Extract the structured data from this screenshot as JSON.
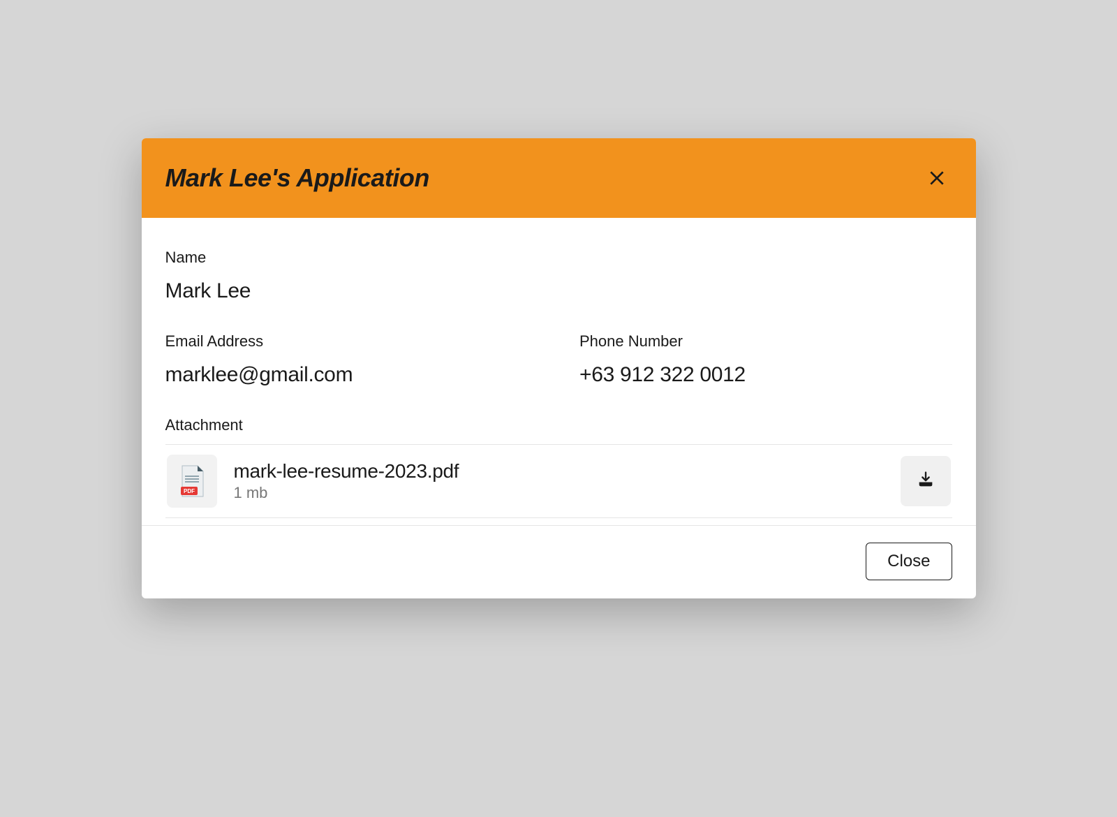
{
  "modal": {
    "title": "Mark Lee's Application",
    "fields": {
      "name": {
        "label": "Name",
        "value": "Mark Lee"
      },
      "email": {
        "label": "Email Address",
        "value": "marklee@gmail.com"
      },
      "phone": {
        "label": "Phone Number",
        "value": "+63 912 322 0012"
      }
    },
    "attachment": {
      "label": "Attachment",
      "filename": "mark-lee-resume-2023.pdf",
      "size": "1 mb",
      "icon": "pdf-file-icon"
    },
    "footer": {
      "close_label": "Close"
    }
  },
  "colors": {
    "accent": "#f2921d"
  }
}
